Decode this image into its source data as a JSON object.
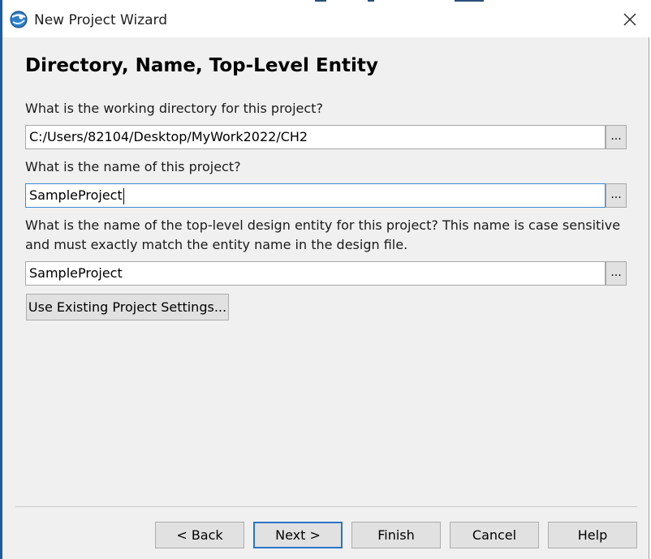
{
  "window": {
    "title": "New Project Wizard"
  },
  "page": {
    "heading": "Directory, Name, Top-Level Entity"
  },
  "directory": {
    "label": "What is the working directory for this project?",
    "value": "C:/Users/82104/Desktop/MyWork2022/CH2",
    "browse_label": "..."
  },
  "project_name": {
    "label": "What is the name of this project?",
    "value": "SampleProject",
    "browse_label": "..."
  },
  "top_level": {
    "label_line1": "What is the name of the top-level design entity for this project? This name is case sensitive",
    "label_line2": "and must exactly match the entity name in the design file.",
    "value": "SampleProject",
    "browse_label": "..."
  },
  "existing_settings_label": "Use Existing Project Settings...",
  "footer": {
    "back_label": "< Back",
    "next_label": "Next >",
    "finish_label": "Finish",
    "cancel_label": "Cancel",
    "help_label": "Help"
  },
  "colors": {
    "focus_border": "#3c8ad8",
    "default_button_border": "#2b74c8",
    "dialog_background": "#f0f0f0"
  },
  "icons": {
    "app": "quartus-globe-icon",
    "close": "close-icon"
  }
}
